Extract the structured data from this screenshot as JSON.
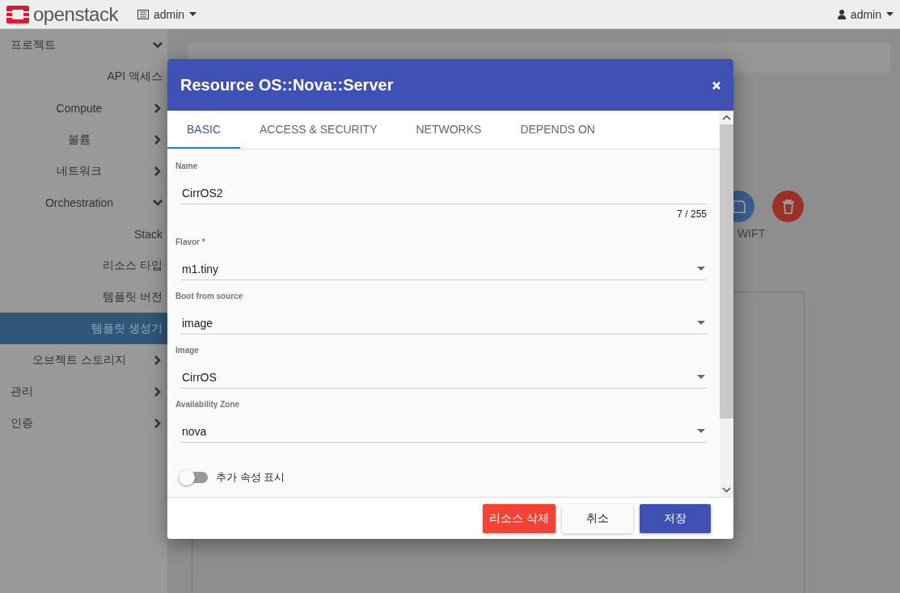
{
  "topbar": {
    "logo": "openstack",
    "project_menu": "admin",
    "user_menu": "admin"
  },
  "sidebar": {
    "items": [
      {
        "label": "프로젝트",
        "selected": false,
        "expanded": true,
        "children": [
          {
            "label": "API 액세스",
            "selected": false
          },
          {
            "label": "Compute",
            "selected": false,
            "expanded": false
          },
          {
            "label": "볼륨",
            "selected": false,
            "expanded": false
          },
          {
            "label": "네트워크",
            "selected": false,
            "expanded": false
          },
          {
            "label": "Orchestration",
            "selected": false,
            "expanded": true,
            "children": [
              {
                "label": "Stack",
                "selected": false
              },
              {
                "label": "리소스 타입",
                "selected": false
              },
              {
                "label": "템플릿 버전",
                "selected": false
              },
              {
                "label": "템플릿 생성기",
                "selected": true
              }
            ]
          },
          {
            "label": "오브젝트 스토리지",
            "selected": false,
            "expanded": false
          }
        ]
      },
      {
        "label": "관리",
        "selected": false,
        "expanded": false
      },
      {
        "label": "인증",
        "selected": false,
        "expanded": false
      }
    ]
  },
  "background": {
    "button_caption": "WIFT"
  },
  "dialog": {
    "title": "Resource OS::Nova::Server",
    "tabs": [
      {
        "label": "BASIC",
        "selected": true
      },
      {
        "label": "ACCESS & SECURITY",
        "selected": false
      },
      {
        "label": "NETWORKS",
        "selected": false
      },
      {
        "label": "DEPENDS ON",
        "selected": false
      }
    ],
    "fields": [
      {
        "kind": "text",
        "label": "Name",
        "value": "CirrOS2",
        "counter": "7 / 255"
      },
      {
        "kind": "select",
        "label": "Flavor *",
        "value": "m1.tiny"
      },
      {
        "kind": "select",
        "label": "Boot from source",
        "value": "image"
      },
      {
        "kind": "select",
        "label": "Image",
        "value": "CirrOS"
      },
      {
        "kind": "select",
        "label": "Availability Zone",
        "value": "nova"
      }
    ],
    "toggle": {
      "label": "추가 속성 표시",
      "on": false
    },
    "buttons": [
      {
        "kind": "danger",
        "label": "리소스 삭제"
      },
      {
        "kind": "plain",
        "label": "취소"
      },
      {
        "kind": "primary",
        "label": "저장"
      }
    ]
  }
}
